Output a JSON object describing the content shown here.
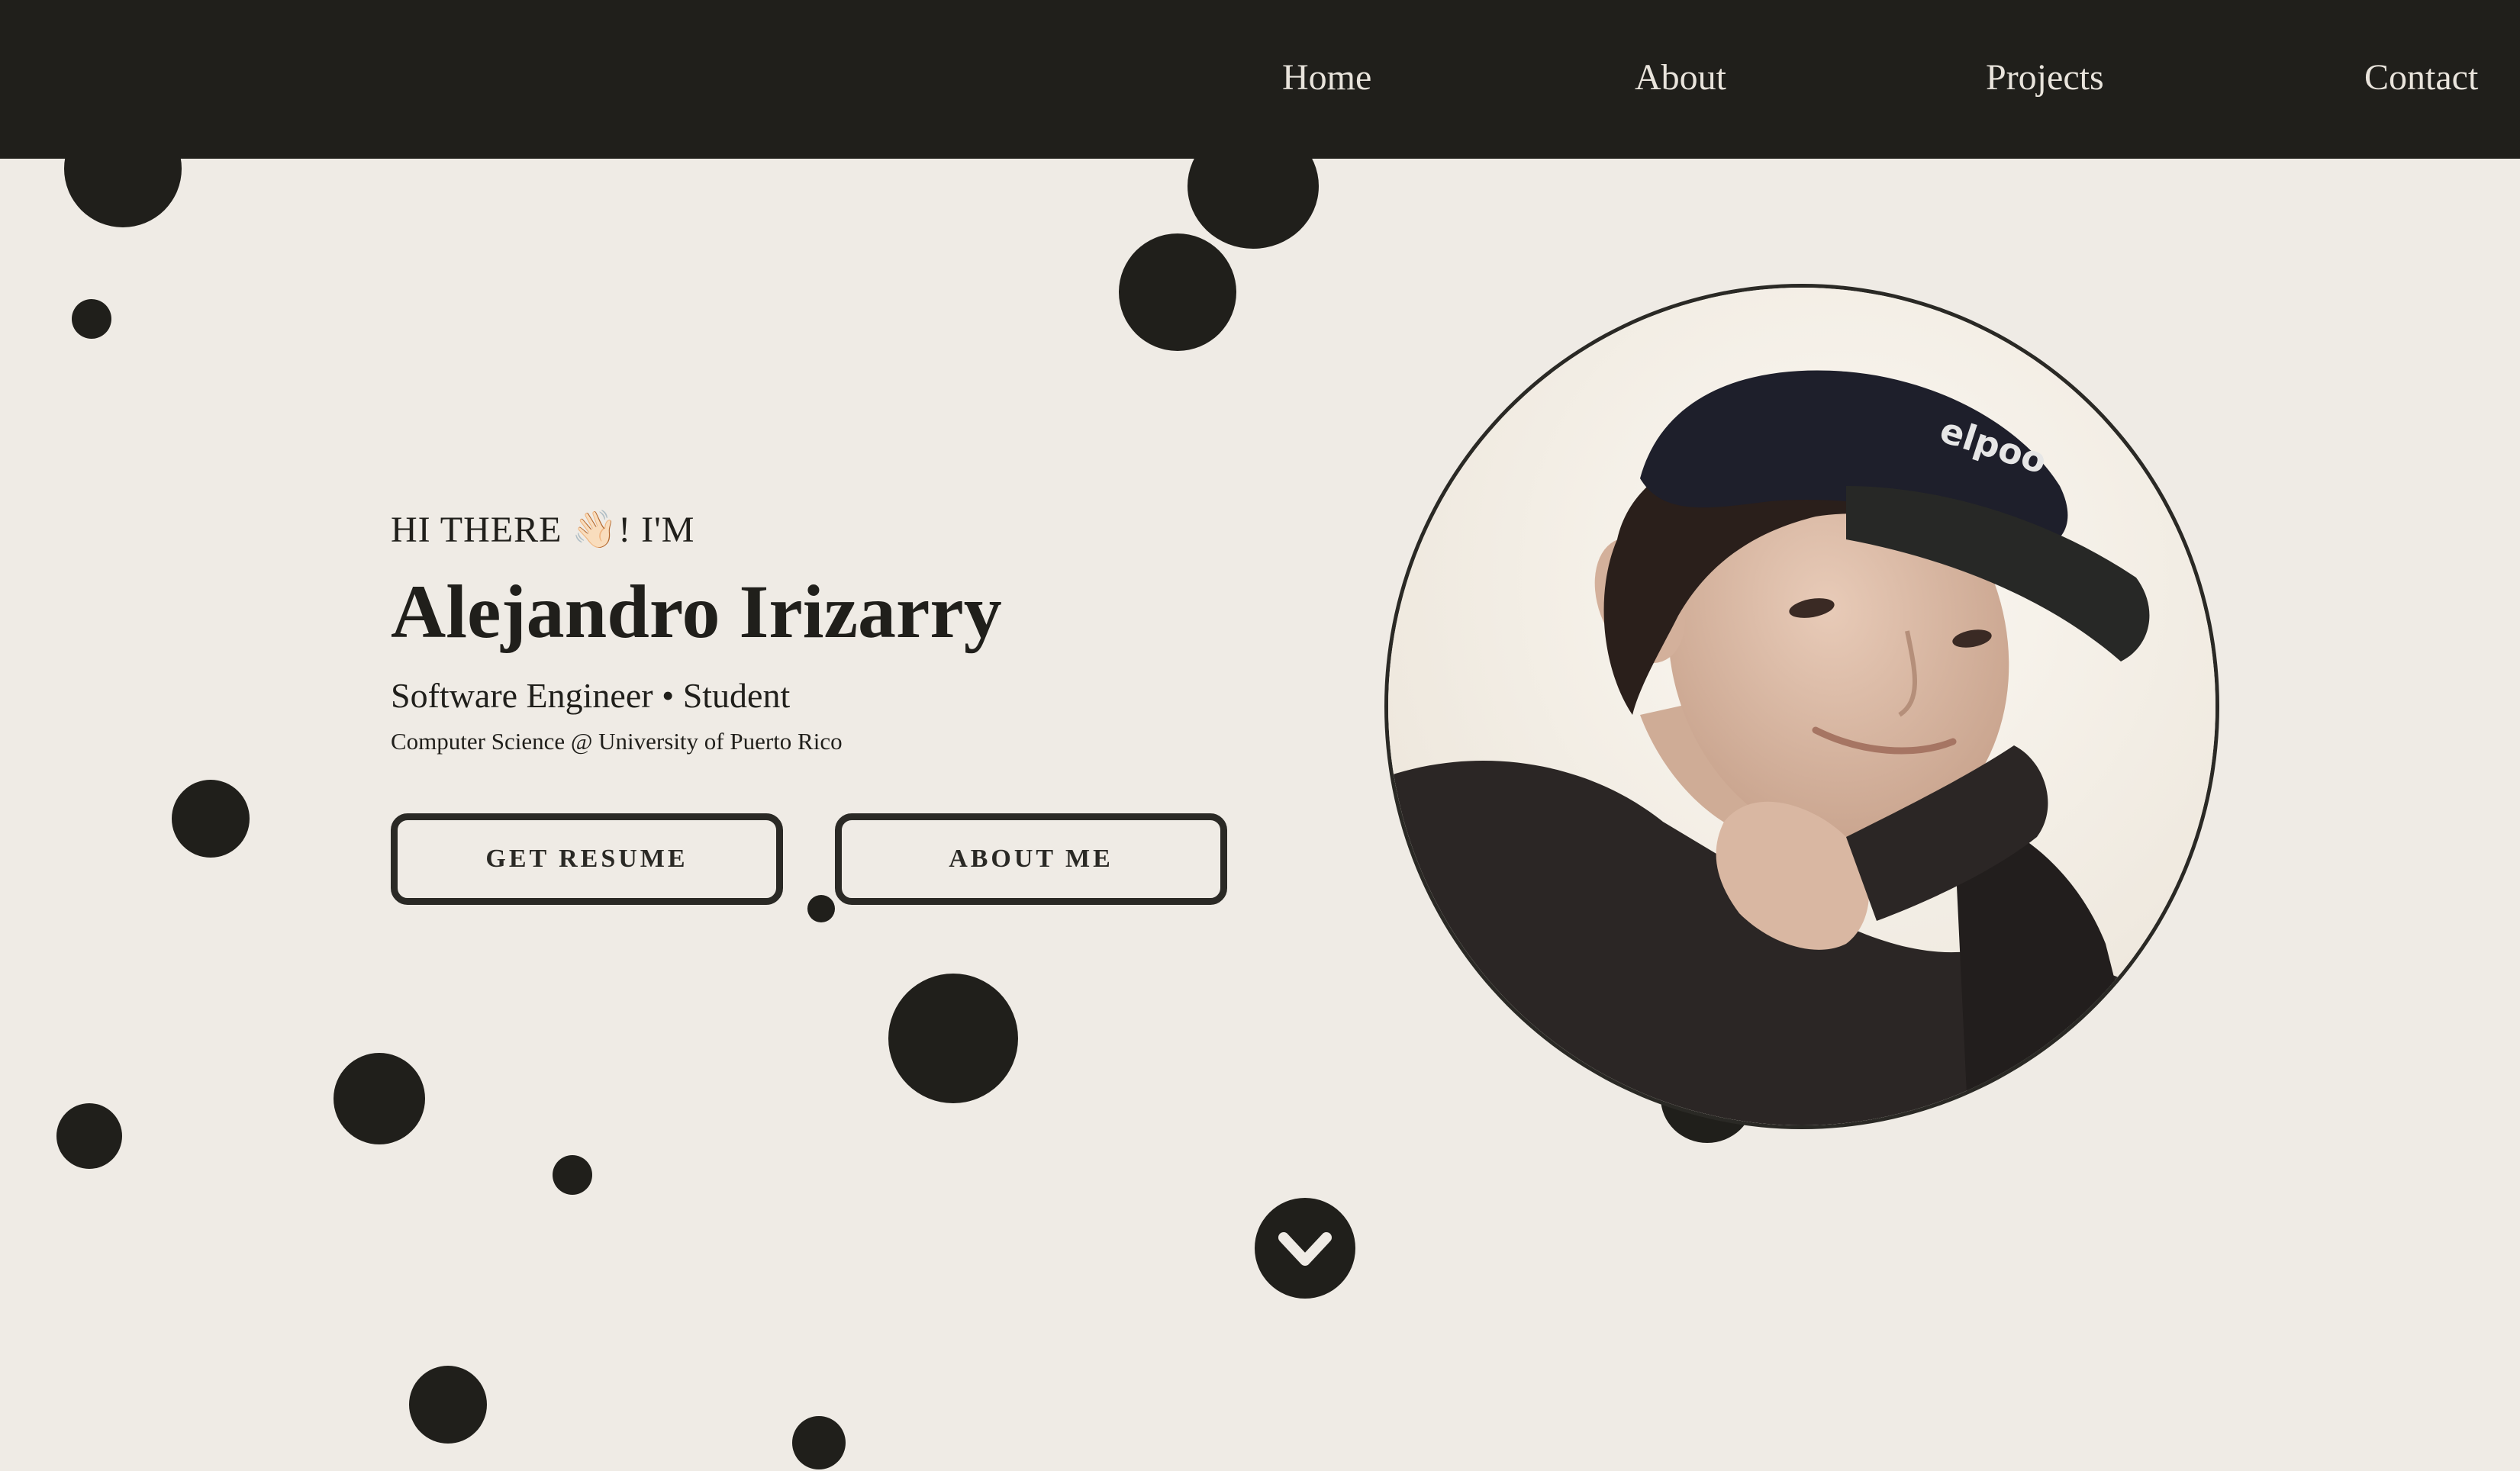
{
  "nav": {
    "items": [
      {
        "label": "Home"
      },
      {
        "label": "About"
      },
      {
        "label": "Projects"
      },
      {
        "label": "Contact"
      }
    ]
  },
  "hero": {
    "greeting": "HI THERE 👋🏻! I'M",
    "name": "Alejandro Irizarry",
    "role": "Software Engineer • Student",
    "school": "Computer Science @ University of Puerto Rico",
    "buttons": {
      "resume": "GET RESUME",
      "about": "ABOUT ME"
    },
    "portrait_alt": "Portrait of Alejandro Irizarry wearing a black cap"
  },
  "colors": {
    "background": "#efebe5",
    "navbar": "#201f1b",
    "nav_text": "#e9e4dc",
    "ink": "#201f1b"
  },
  "icons": {
    "scroll_down": "chevron-down-icon"
  }
}
